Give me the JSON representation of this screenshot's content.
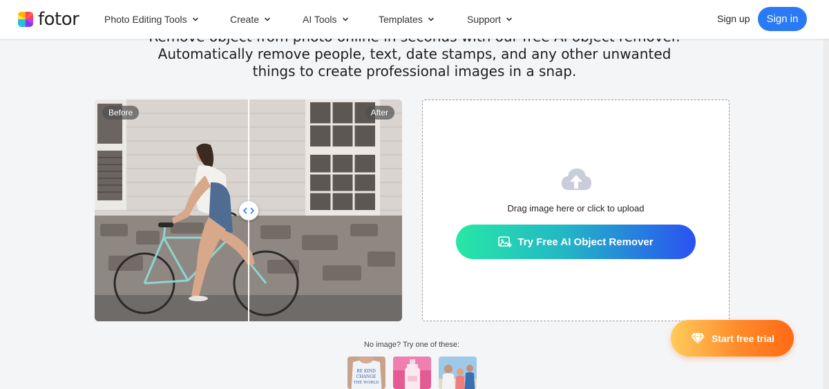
{
  "header": {
    "brand": "fotor",
    "nav": [
      {
        "label": "Photo Editing Tools"
      },
      {
        "label": "Create"
      },
      {
        "label": "AI Tools"
      },
      {
        "label": "Templates"
      },
      {
        "label": "Support"
      }
    ],
    "signup_label": "Sign up",
    "signin_label": "Sign in"
  },
  "intro": {
    "line1": "Remove object from photo online in seconds with our free AI object remover.",
    "line2": "Automatically remove people, text, date stamps, and any other unwanted",
    "line3": "things to create professional images in a snap."
  },
  "compare": {
    "before_label": "Before",
    "after_label": "After"
  },
  "upload": {
    "drag_text": "Drag image here or click to upload",
    "button_label": "Try Free AI Object Remover"
  },
  "samples": {
    "prompt": "No image? Try one of these:",
    "shirt_text_1": "BE KIND",
    "shirt_text_2": "CHANGE",
    "shirt_text_3": "THE WORLD"
  },
  "trial": {
    "label": "Start free trial"
  },
  "colors": {
    "primary_blue": "#2a7af5",
    "cta_gradient_start": "#27e7a5",
    "cta_gradient_end": "#2a52f2",
    "trial_gradient_start": "#ffcb5a",
    "trial_gradient_end": "#ff6a14"
  }
}
